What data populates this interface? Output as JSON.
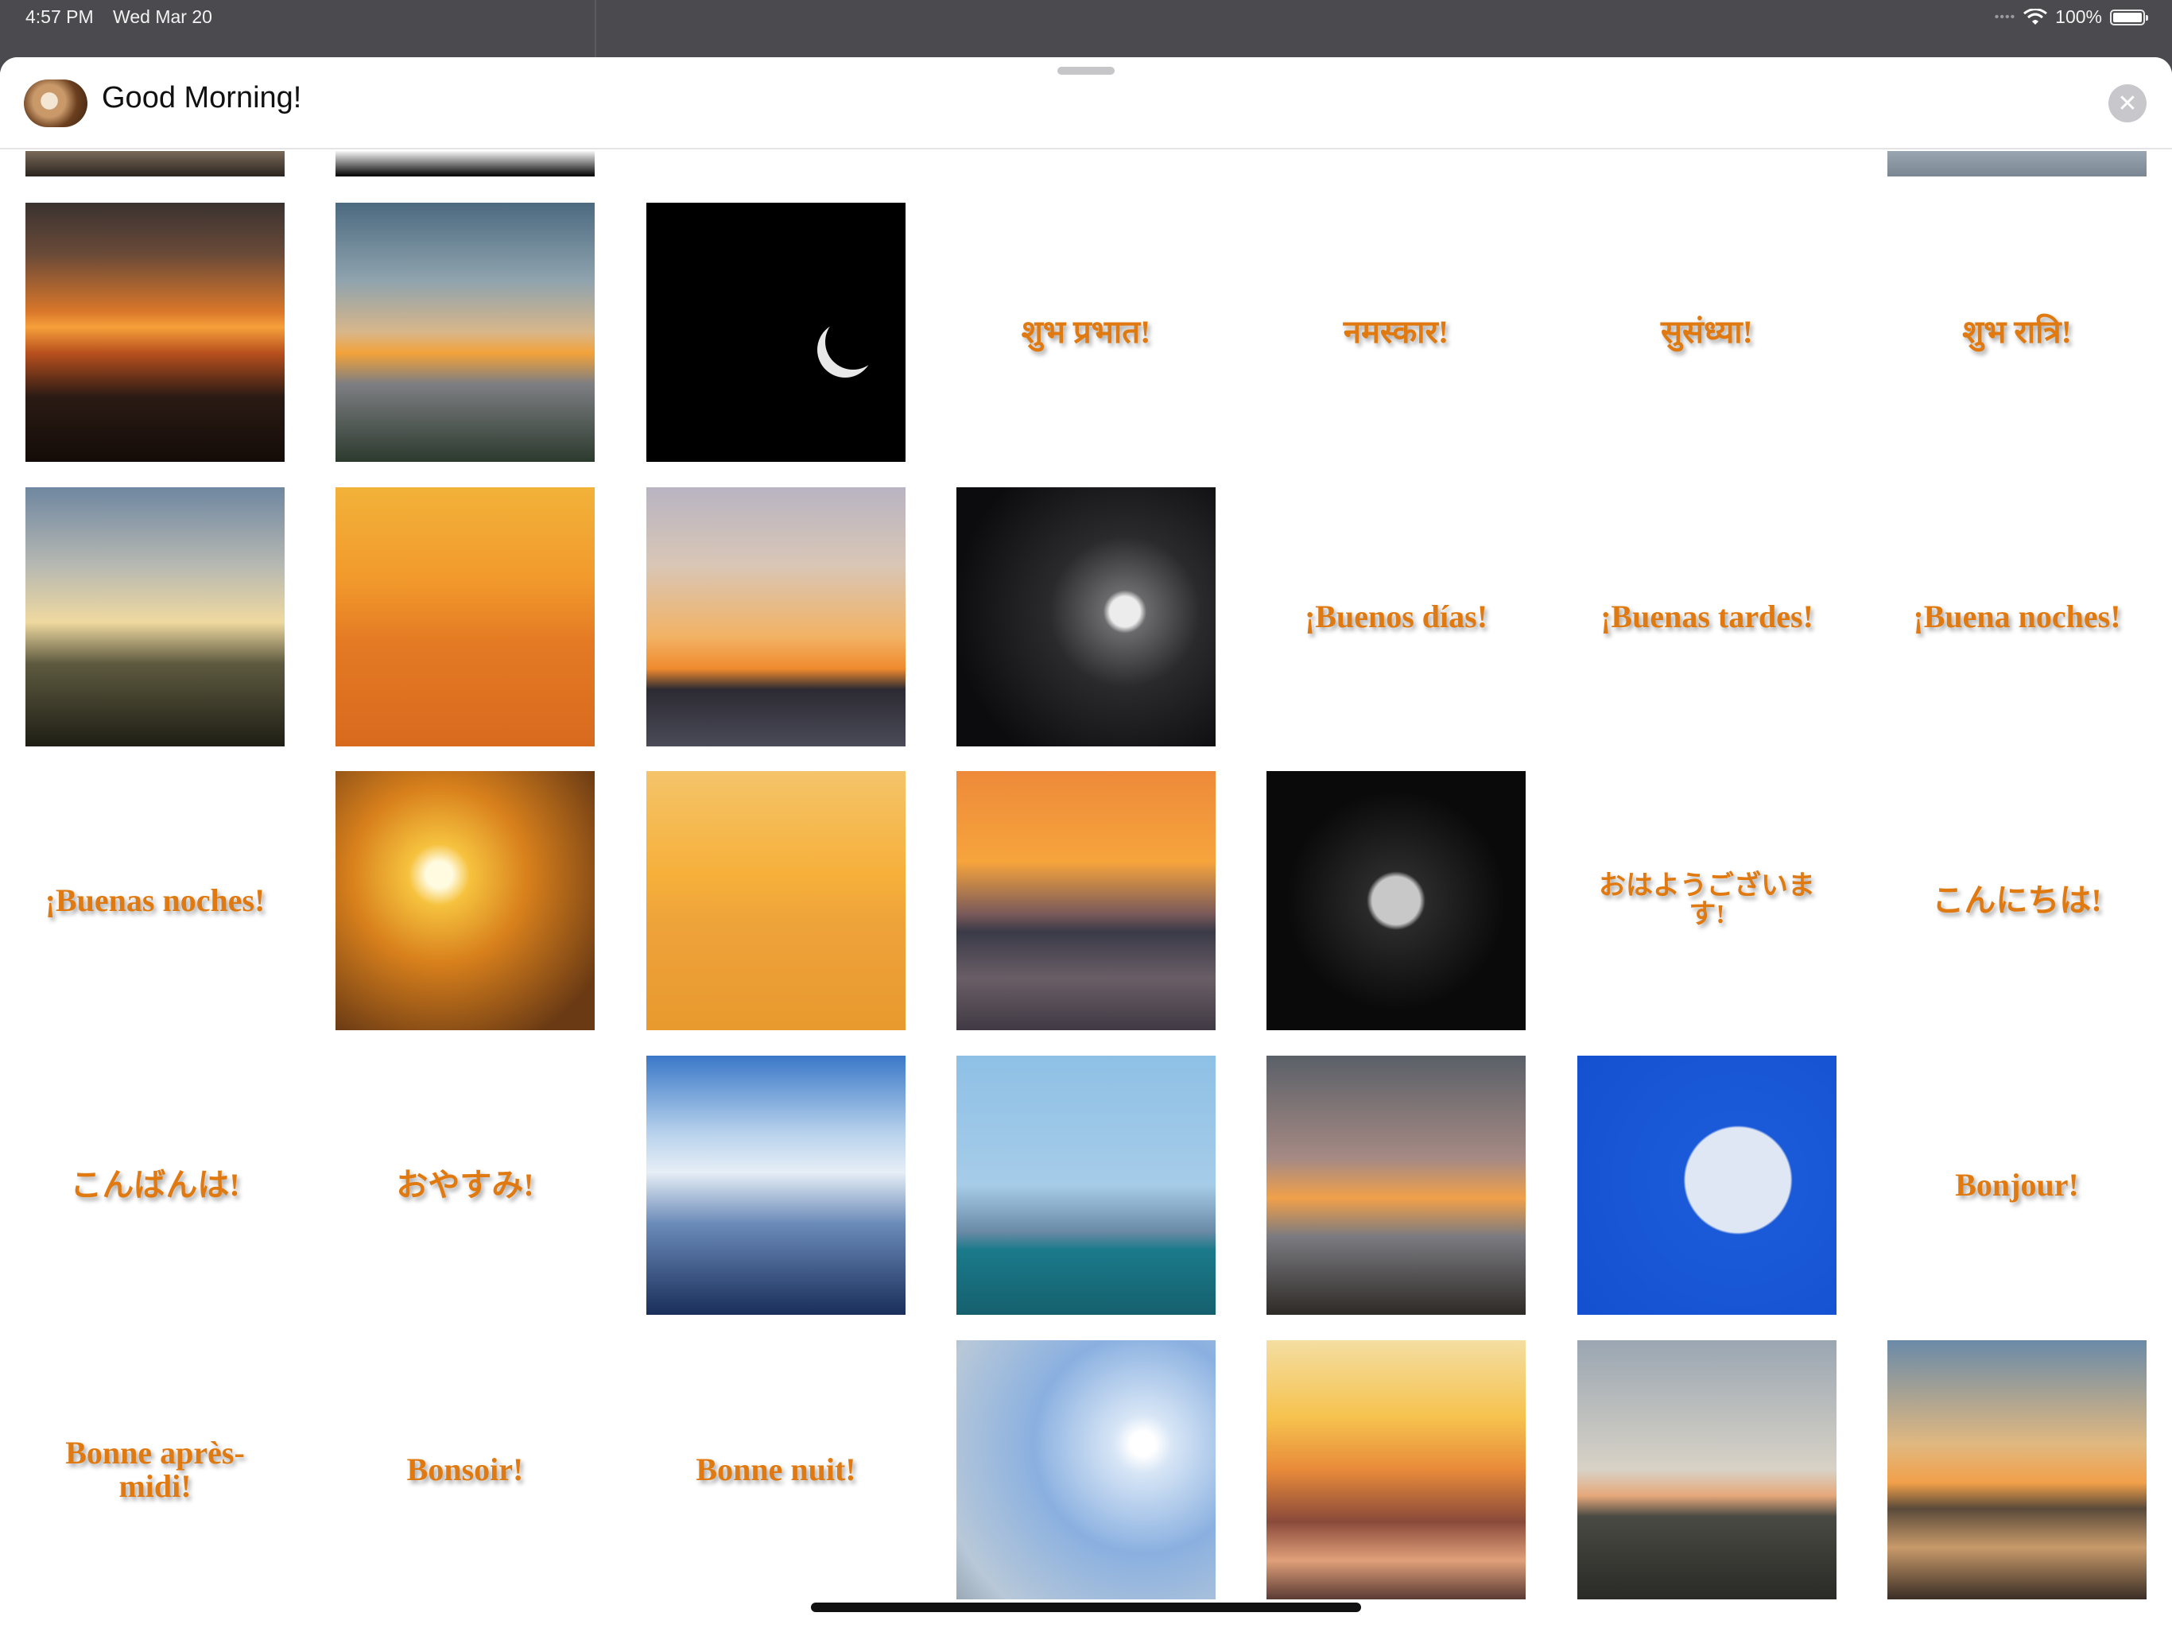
{
  "status_bar": {
    "time": "4:57 PM",
    "date": "Wed Mar 20",
    "battery": "100%",
    "icons": [
      "signal-dots-icon",
      "wifi-icon",
      "battery-icon"
    ]
  },
  "sheet": {
    "title": "Good Morning!",
    "close_icon": "✕"
  },
  "tiles": {
    "hindi_morning": "शुभ प्रभात!",
    "hindi_namaskar": "नमस्कार!",
    "hindi_evening": "सुसंध्या!",
    "hindi_night": "शुभ रात्रि!",
    "es_morning": "¡Buenos días!",
    "es_afternoon": "¡Buenas tardes!",
    "es_night_a": "¡Buena noches!",
    "es_night_b": "¡Buenas noches!",
    "ja_morning": "おはようございます!",
    "ja_hello": "こんにちは!",
    "ja_evening": "こんばんは!",
    "ja_night": "おやすみ!",
    "fr_hello": "Bonjour!",
    "fr_afternoon": "Bonne après-midi!",
    "fr_evening": "Bonsoir!",
    "fr_night": "Bonne nuit!"
  },
  "colors": {
    "sticker_text": "#e07a10",
    "sheet_bg": "#ffffff",
    "backdrop": "#4a4a4f"
  }
}
